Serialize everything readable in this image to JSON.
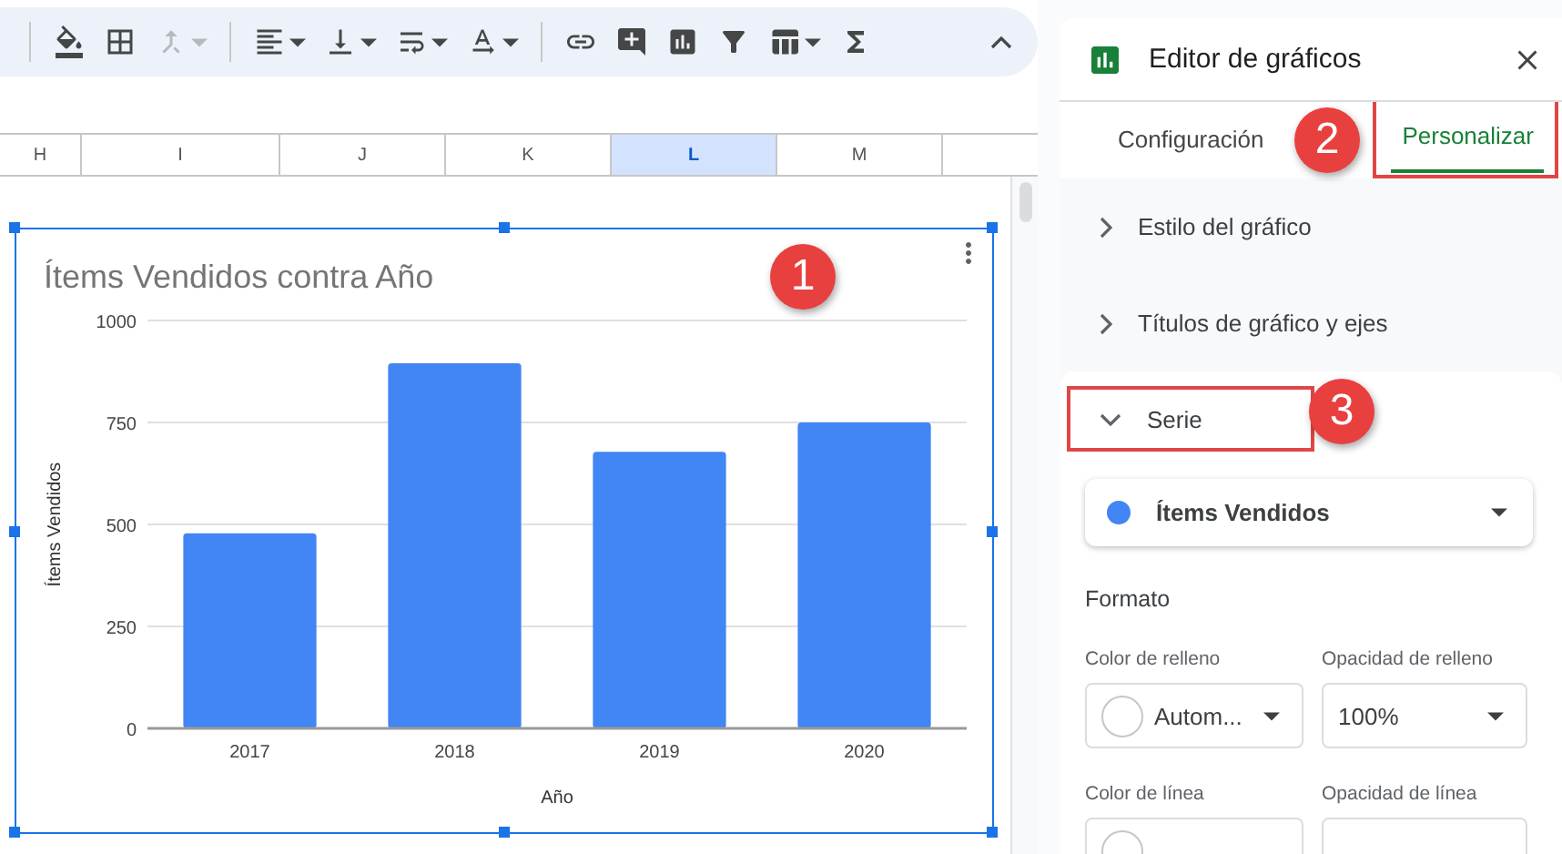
{
  "toolbar": [
    [
      {
        "kind": "fill-color",
        "disabled": false,
        "has_menu": false
      },
      {
        "kind": "borders",
        "disabled": false,
        "has_menu": false
      },
      {
        "kind": "merge",
        "disabled": true,
        "has_menu": true
      }
    ],
    [
      {
        "kind": "align",
        "disabled": false,
        "has_menu": true
      },
      {
        "kind": "valign",
        "disabled": false,
        "has_menu": true
      },
      {
        "kind": "wrap",
        "disabled": false,
        "has_menu": true
      },
      {
        "kind": "rotate",
        "disabled": false,
        "has_menu": true
      }
    ],
    [
      {
        "kind": "link",
        "disabled": false,
        "has_menu": false
      },
      {
        "kind": "comment",
        "disabled": false,
        "has_menu": false
      },
      {
        "kind": "chart",
        "disabled": false,
        "has_menu": false
      },
      {
        "kind": "filter",
        "disabled": false,
        "has_menu": false
      },
      {
        "kind": "table",
        "disabled": false,
        "has_menu": true
      },
      {
        "kind": "functions",
        "disabled": false,
        "has_menu": false
      }
    ]
  ],
  "columns": [
    {
      "label": "H",
      "selected": false
    },
    {
      "label": "I",
      "selected": false
    },
    {
      "label": "J",
      "selected": false
    },
    {
      "label": "K",
      "selected": false
    },
    {
      "label": "L",
      "selected": true
    },
    {
      "label": "M",
      "selected": false
    }
  ],
  "chart": {
    "chart_data": {
      "type": "bar",
      "title": "Ítems Vendidos contra Año",
      "xlabel": "Año",
      "ylabel": "Ítems Vendidos",
      "categories": [
        "2017",
        "2018",
        "2019",
        "2020"
      ],
      "series": [
        {
          "color": "#4285f4",
          "values": [
            478,
            895,
            678,
            750
          ]
        }
      ],
      "ylim": [
        0,
        1000
      ],
      "yticks": [
        0,
        250,
        500,
        750,
        1000
      ],
      "grid": true
    }
  },
  "callouts": [
    {
      "number": "1"
    },
    {
      "number": "2"
    },
    {
      "number": "3"
    }
  ],
  "editor": {
    "title": "Editor de gráficos",
    "tabs": [
      {
        "label": "Configuración",
        "selected": false,
        "highlighted": false
      },
      {
        "label": "Personalizar",
        "selected": true,
        "highlighted": true
      }
    ],
    "sections": [
      {
        "label": "Estilo del gráfico",
        "expanded": false,
        "highlighted": false
      },
      {
        "label": "Títulos de gráfico y ejes",
        "expanded": false,
        "highlighted": false
      },
      {
        "label": "Serie",
        "expanded": true,
        "highlighted": true
      }
    ],
    "series_select": {
      "value": "Ítems Vendidos",
      "color": "#4285f4"
    },
    "format_heading": "Formato",
    "fields": [
      {
        "label": "Color de relleno",
        "value": "Autom...",
        "kind": "color"
      },
      {
        "label": "Opacidad de relleno",
        "value": "100%",
        "kind": "select"
      },
      {
        "label": "Color de línea",
        "kind": "color"
      },
      {
        "label": "Opacidad de línea",
        "kind": "select"
      }
    ]
  }
}
